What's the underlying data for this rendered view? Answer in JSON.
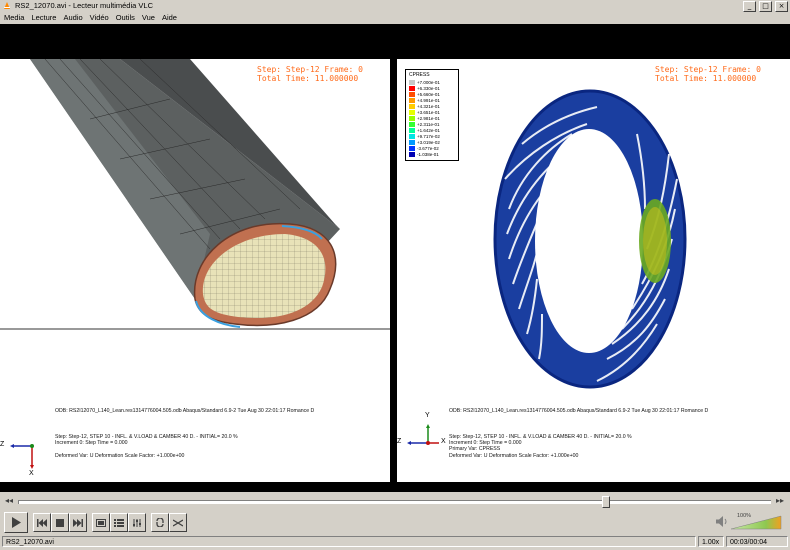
{
  "window": {
    "title": "RS2_12070.avi - Lecteur multimédia VLC",
    "minimize_icon": "minimize-icon",
    "maximize_icon": "maximize-icon",
    "close_icon": "close-icon"
  },
  "menu": [
    "Media",
    "Lecture",
    "Audio",
    "Vidéo",
    "Outils",
    "Vue",
    "Aide"
  ],
  "left_view": {
    "step_line": "Step: Step-12   Frame: 0",
    "time_line": "Total Time: 11.000000",
    "odb_line": "ODB: RS2I12070_L140_Lean.res1314776004.505.odb   Abaqus/Standard 6.9-2    Tue Aug 30 22:01:17 Romance D",
    "step_desc": "Step: Step-12, STEP 10 - INFL. & V.LOAD & CAMBER 40 D. - INITIAL= 20.0 %",
    "increment": "Increment     0: Step Time =    0.000",
    "deformed": "Deformed Var: U   Deformation Scale Factor: +1.000e+00",
    "axis_z": "Z",
    "axis_x": "X"
  },
  "right_view": {
    "step_line": "Step: Step-12   Frame: 0",
    "time_line": "Total Time: 11.000000",
    "odb_line": "ODB: RS2I12070_L140_Lean.res1314776004.505.odb   Abaqus/Standard 6.9-2    Tue Aug 30 22:01:17 Romance D",
    "step_desc": "Step: Step-12, STEP 10 - INFL. & V.LOAD & CAMBER 40 D. - INITIAL= 20.0 %",
    "increment": "Increment     0: Step Time =    0.000",
    "primary": "Primary Var: CPRESS",
    "deformed": "Deformed Var: U   Deformation Scale Factor: +1.000e+00",
    "axis_y": "Y",
    "axis_z": "Z",
    "axis_x": "X",
    "legend": {
      "title": "CPRESS",
      "values": [
        "+7.000e-01",
        "+6.330e-01",
        "+5.660e-01",
        "+4.991e-01",
        "+4.321e-01",
        "+3.651e-01",
        "+2.981e-01",
        "+2.311e-01",
        "+1.642e-01",
        "+9.717e-02",
        "+3.019e-02",
        "-3.677e-02",
        "-1.038e-01"
      ],
      "colors": [
        "#c8c8c8",
        "#ff0000",
        "#ff4d00",
        "#ff9900",
        "#ffcc00",
        "#e6ff00",
        "#99ff00",
        "#33ff33",
        "#00ff99",
        "#00e6e6",
        "#0099ff",
        "#0033ff",
        "#0000b3"
      ]
    }
  },
  "playback": {
    "position": 0.78
  },
  "controls": {
    "play_icon": "play-icon",
    "prev_icon": "previous-icon",
    "stop_icon": "stop-icon",
    "next_icon": "next-icon",
    "fullscreen_icon": "fullscreen-icon",
    "playlist_icon": "playlist-icon",
    "extended_icon": "extended-settings-icon",
    "loop_icon": "loop-icon",
    "shuffle_icon": "shuffle-icon",
    "volume_icon": "volume-icon",
    "volume_label": "100%",
    "volume_level": 1.0
  },
  "status": {
    "filename": "RS2_12070.avi",
    "speed": "1.00x",
    "time": "00:03/00:04"
  }
}
